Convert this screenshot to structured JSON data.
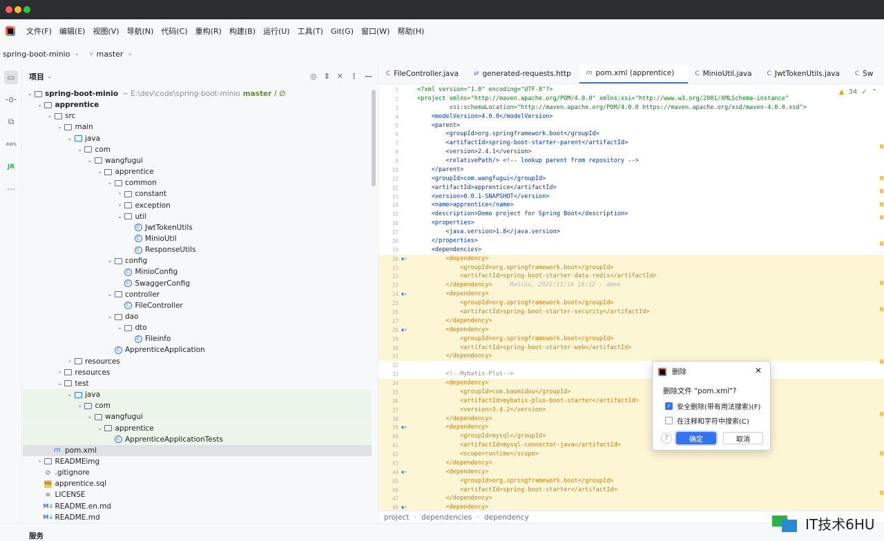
{
  "menu": [
    "文件(F)",
    "编辑(E)",
    "视图(V)",
    "导航(N)",
    "代码(C)",
    "重构(R)",
    "构建(B)",
    "运行(U)",
    "工具(T)",
    "Git(G)",
    "窗口(W)",
    "帮助(H)"
  ],
  "project_bar": {
    "project_name": "spring-boot-minio",
    "branch": "master"
  },
  "left_strip": [
    "folder-icon",
    "commit-icon",
    "structure-icon",
    "aws-icon",
    "jrebel-icon",
    "more-icon"
  ],
  "project_panel": {
    "title": "项目",
    "tree": [
      {
        "label": "spring-boot-minio",
        "indent": 0,
        "arrow": "v",
        "icon": "folder",
        "bold": true,
        "hint": "~ E:\\dev\\code\\spring-boot-minio",
        "tag": "master / ∅"
      },
      {
        "label": "apprentice",
        "indent": 1,
        "arrow": "v",
        "icon": "folder",
        "bold": true
      },
      {
        "label": "src",
        "indent": 2,
        "arrow": "v",
        "icon": "folder"
      },
      {
        "label": "main",
        "indent": 3,
        "arrow": "v",
        "icon": "folder"
      },
      {
        "label": "java",
        "indent": 4,
        "arrow": "v",
        "icon": "folder-blue"
      },
      {
        "label": "com",
        "indent": 5,
        "arrow": "v",
        "icon": "package"
      },
      {
        "label": "wangfugui",
        "indent": 6,
        "arrow": "v",
        "icon": "package"
      },
      {
        "label": "apprentice",
        "indent": 7,
        "arrow": "v",
        "icon": "package"
      },
      {
        "label": "common",
        "indent": 8,
        "arrow": "v",
        "icon": "package"
      },
      {
        "label": "constant",
        "indent": 9,
        "arrow": ">",
        "icon": "package"
      },
      {
        "label": "exception",
        "indent": 9,
        "arrow": ">",
        "icon": "package"
      },
      {
        "label": "util",
        "indent": 9,
        "arrow": "v",
        "icon": "package"
      },
      {
        "label": "JwtTokenUtils",
        "indent": 10,
        "arrow": "",
        "icon": "class"
      },
      {
        "label": "MinioUtil",
        "indent": 10,
        "arrow": "",
        "icon": "class"
      },
      {
        "label": "ResponseUtils",
        "indent": 10,
        "arrow": "",
        "icon": "class"
      },
      {
        "label": "config",
        "indent": 8,
        "arrow": "v",
        "icon": "package"
      },
      {
        "label": "MinioConfig",
        "indent": 9,
        "arrow": "",
        "icon": "class"
      },
      {
        "label": "SwaggerConfig",
        "indent": 9,
        "arrow": "",
        "icon": "class"
      },
      {
        "label": "controller",
        "indent": 8,
        "arrow": "v",
        "icon": "package"
      },
      {
        "label": "FileController",
        "indent": 9,
        "arrow": "",
        "icon": "class"
      },
      {
        "label": "dao",
        "indent": 8,
        "arrow": "v",
        "icon": "package"
      },
      {
        "label": "dto",
        "indent": 9,
        "arrow": "v",
        "icon": "package"
      },
      {
        "label": "Fileinfo",
        "indent": 10,
        "arrow": "",
        "icon": "class"
      },
      {
        "label": "ApprenticeApplication",
        "indent": 8,
        "arrow": "",
        "icon": "class"
      },
      {
        "label": "resources",
        "indent": 4,
        "arrow": ">",
        "icon": "folder"
      },
      {
        "label": "resources",
        "indent": 3,
        "arrow": ">",
        "icon": "folder"
      },
      {
        "label": "test",
        "indent": 3,
        "arrow": "v",
        "icon": "folder"
      },
      {
        "label": "java",
        "indent": 4,
        "arrow": "v",
        "icon": "folder-blue",
        "green": true
      },
      {
        "label": "com",
        "indent": 5,
        "arrow": "v",
        "icon": "package",
        "green": true
      },
      {
        "label": "wangfugui",
        "indent": 6,
        "arrow": "v",
        "icon": "package",
        "green": true
      },
      {
        "label": "apprentice",
        "indent": 7,
        "arrow": "v",
        "icon": "package",
        "green": true
      },
      {
        "label": "ApprenticeApplicationTests",
        "indent": 8,
        "arrow": "",
        "icon": "class",
        "green": true
      },
      {
        "label": "pom.xml",
        "indent": 2,
        "arrow": "",
        "icon": "maven",
        "selected": true
      },
      {
        "label": "READMEimg",
        "indent": 1,
        "arrow": ">",
        "icon": "folder"
      },
      {
        "label": ".gitignore",
        "indent": 1,
        "arrow": "",
        "icon": "gitignore"
      },
      {
        "label": "apprentice.sql",
        "indent": 1,
        "arrow": "",
        "icon": "sql"
      },
      {
        "label": "LICENSE",
        "indent": 1,
        "arrow": "",
        "icon": "text"
      },
      {
        "label": "README.en.md",
        "indent": 1,
        "arrow": "",
        "icon": "md"
      },
      {
        "label": "README.md",
        "indent": 1,
        "arrow": "",
        "icon": "md"
      }
    ]
  },
  "tabs": [
    {
      "label": "FileController.java",
      "icon": "C",
      "active": false
    },
    {
      "label": "generated-requests.http",
      "icon": "⇄",
      "active": false
    },
    {
      "label": "pom.xml (apprentice)",
      "icon": "m",
      "active": true
    },
    {
      "label": "MinioUtil.java",
      "icon": "C",
      "active": false
    },
    {
      "label": "JwtTokenUtils.java",
      "icon": "C",
      "active": false
    },
    {
      "label": "Sw",
      "icon": "C",
      "active": false
    }
  ],
  "analysis": {
    "warnings": "34",
    "ok": "✓"
  },
  "code_lines": [
    {
      "n": "1",
      "t": "<?xml version=\"1.0\" encoding=\"UTF-8\"?>"
    },
    {
      "n": "2",
      "t": "<project xmlns=\"http://maven.apache.org/POM/4.0.0\" xmlns:xsi=\"http://www.w3.org/2001/XMLSchema-instance\""
    },
    {
      "n": "3",
      "t": "         xsi:schemaLocation=\"http://maven.apache.org/POM/4.0.0 https://maven.apache.org/xsd/maven-4.0.0.xsd\">"
    },
    {
      "n": "4",
      "t": "    <modelVersion>4.0.0</modelVersion>"
    },
    {
      "n": "5",
      "t": "    <parent>"
    },
    {
      "n": "6",
      "t": "        <groupId>org.springframework.boot</groupId>"
    },
    {
      "n": "7",
      "t": "        <artifactId>spring-boot-starter-parent</artifactId>"
    },
    {
      "n": "8",
      "t": "        <version>2.4.1</version>"
    },
    {
      "n": "9",
      "t": "        <relativePath/> <!-- lookup parent from repository -->"
    },
    {
      "n": "10",
      "t": "    </parent>"
    },
    {
      "n": "11",
      "t": "    <groupId>com.wangfugui</groupId>"
    },
    {
      "n": "12",
      "t": "    <artifactId>apprentice</artifactId>"
    },
    {
      "n": "13",
      "t": "    <version>0.0.1-SNAPSHOT</version>"
    },
    {
      "n": "14",
      "t": "    <name>apprentice</name>"
    },
    {
      "n": "15",
      "t": "    <description>Demo project for Spring Boot</description>"
    },
    {
      "n": "16",
      "t": "    <properties>"
    },
    {
      "n": "17",
      "t": "        <java.version>1.8</java.version>"
    },
    {
      "n": "18",
      "t": "    </properties>"
    },
    {
      "n": "19",
      "t": "    <dependencies>"
    },
    {
      "n": "20",
      "t": "        <dependency>",
      "hl": true,
      "mark": true
    },
    {
      "n": "21",
      "t": "            <groupId>org.springframework.boot</groupId>",
      "hl": true
    },
    {
      "n": "22",
      "t": "            <artifactId>spring-boot-starter-data-redis</artifactId>",
      "hl": true
    },
    {
      "n": "23",
      "t": "        </dependency>",
      "hl": true,
      "blame": "MaSiGu, 2021/11/16 18:12 · dmeo"
    },
    {
      "n": "24",
      "t": "        <dependency>",
      "hl": true,
      "mark": true
    },
    {
      "n": "25",
      "t": "            <groupId>org.springframework.boot</groupId>",
      "hl": true
    },
    {
      "n": "26",
      "t": "            <artifactId>spring-boot-starter-security</artifactId>",
      "hl": true
    },
    {
      "n": "27",
      "t": "        </dependency>",
      "hl": true
    },
    {
      "n": "28",
      "t": "        <dependency>",
      "hl": true,
      "mark": true
    },
    {
      "n": "29",
      "t": "            <groupId>org.springframework.boot</groupId>",
      "hl": true
    },
    {
      "n": "30",
      "t": "            <artifactId>spring-boot-starter-web</artifactId>",
      "hl": true
    },
    {
      "n": "31",
      "t": "        </dependency>",
      "hl": true
    },
    {
      "n": "32",
      "t": ""
    },
    {
      "n": "33",
      "t": "        <!--Mybatis-Plus-->"
    },
    {
      "n": "34",
      "t": "        <dependency>",
      "hl": true
    },
    {
      "n": "35",
      "t": "            <groupId>com.baomidou</groupId>",
      "hl": true
    },
    {
      "n": "36",
      "t": "            <artifactId>mybatis-plus-boot-starter</artifactId>",
      "hl": true
    },
    {
      "n": "37",
      "t": "            <version>3.4.2</version>",
      "hl": true
    },
    {
      "n": "38",
      "t": "        </dependency>",
      "hl": true
    },
    {
      "n": "39",
      "t": "        <dependency>",
      "hl": true,
      "mark": true
    },
    {
      "n": "40",
      "t": "            <groupId>mysql</groupId>",
      "hl": true
    },
    {
      "n": "41",
      "t": "            <artifactId>mysql-connector-java</artifactId>",
      "hl": true
    },
    {
      "n": "42",
      "t": "            <scope>runtime</scope>",
      "hl": true
    },
    {
      "n": "43",
      "t": "        </dependency>",
      "hl": true
    },
    {
      "n": "44",
      "t": "        <dependency>",
      "hl": true,
      "mark": true
    },
    {
      "n": "45",
      "t": "            <groupId>org.springframework.boot</groupId>",
      "hl": true
    },
    {
      "n": "46",
      "t": "            <artifactId>spring-boot-starter</artifactId>",
      "hl": true
    },
    {
      "n": "47",
      "t": "        </dependency>",
      "hl": true
    },
    {
      "n": "48",
      "t": "        <dependency>",
      "hl": true,
      "mark": true
    }
  ],
  "breadcrumb": [
    "project",
    "dependencies",
    "dependency"
  ],
  "bottom": {
    "services": "服务"
  },
  "watermark": "IT技术6HU",
  "dialog": {
    "title": "删除",
    "message": "删除文件 \"pom.xml\"?",
    "option1": "安全删除(带有用法搜索)(F)",
    "option1_checked": true,
    "option2": "在注释和字符中搜索(C)",
    "option2_checked": false,
    "ok": "确定",
    "cancel": "取消",
    "help": "?"
  },
  "colors": {
    "accent": "#3574f0",
    "highlight": "#fdf6d5",
    "test_green": "#ebf5e9"
  }
}
